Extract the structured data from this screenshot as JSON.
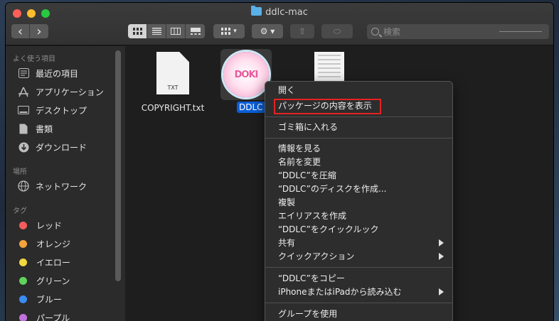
{
  "window": {
    "title": "ddlc-mac"
  },
  "toolbar": {
    "back_glyph": "‹",
    "forward_glyph": "›",
    "view_icons": [
      "icon-view-icon",
      "list-view-icon",
      "column-view-icon",
      "gallery-view-icon"
    ],
    "group_glyph": "▾",
    "action_glyph": "⚙ ▾",
    "share_glyph": "⇧",
    "tag_glyph": "⬭",
    "search_placeholder": "検索"
  },
  "sidebar": {
    "sections": {
      "favorites": "よく使う項目",
      "locations": "場所",
      "tags": "タグ"
    },
    "favorites": [
      {
        "label": "最近の項目",
        "icon": "clock-icon"
      },
      {
        "label": "アプリケーション",
        "icon": "applications-icon"
      },
      {
        "label": "デスクトップ",
        "icon": "desktop-icon"
      },
      {
        "label": "書類",
        "icon": "documents-icon"
      },
      {
        "label": "ダウンロード",
        "icon": "download-icon"
      }
    ],
    "locations": [
      {
        "label": "ネットワーク",
        "icon": "network-icon"
      }
    ],
    "tags": [
      {
        "label": "レッド",
        "color": "#f25d5b"
      },
      {
        "label": "オレンジ",
        "color": "#f5a33b"
      },
      {
        "label": "イエロー",
        "color": "#f3d83d"
      },
      {
        "label": "グリーン",
        "color": "#5fd35a"
      },
      {
        "label": "ブルー",
        "color": "#3a8df2"
      },
      {
        "label": "パープル",
        "color": "#c071dc"
      }
    ]
  },
  "files": [
    {
      "name": "COPYRIGHT.txt",
      "type_label": "TXT"
    },
    {
      "name": "DDLC",
      "logo": "DOKI"
    },
    {
      "name": ""
    }
  ],
  "context_menu": {
    "items": [
      "開く",
      "パッケージの内容を表示",
      "ゴミ箱に入れる",
      "情報を見る",
      "名前を変更",
      "“DDLC”を圧縮",
      "“DDLC”のディスクを作成...",
      "複製",
      "エイリアスを作成",
      "“DDLC”をクイックルック",
      "共有",
      "クイックアクション",
      "“DDLC”をコピー",
      "iPhoneまたはiPadから読み込む",
      "グループを使用"
    ]
  }
}
